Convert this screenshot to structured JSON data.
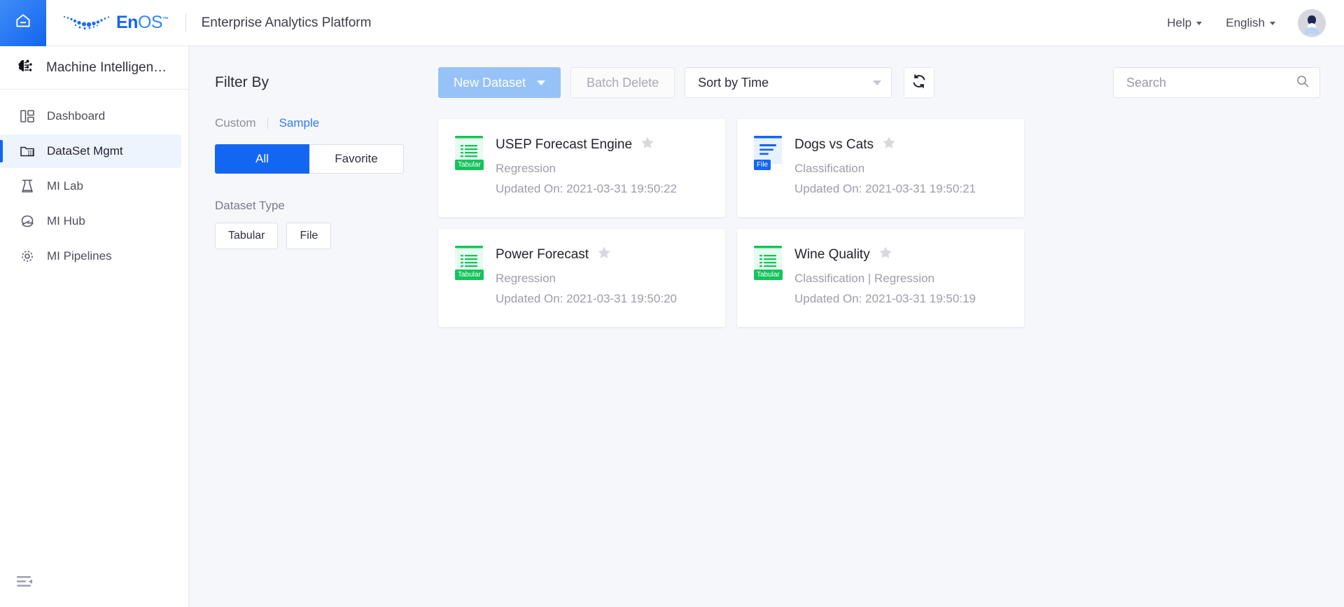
{
  "header": {
    "home_icon": "home-icon",
    "logo_en": "En",
    "logo_os": "OS",
    "logo_tm": "™",
    "platform_title": "Enterprise Analytics Platform",
    "help_label": "Help",
    "language_label": "English",
    "avatar_alt": "user-avatar"
  },
  "sidebar": {
    "module_title": "Machine Intelligen…",
    "module_icon": "brain-chip-icon",
    "items": [
      {
        "label": "Dashboard",
        "icon": "dashboard-icon",
        "active": false
      },
      {
        "label": "DataSet Mgmt",
        "icon": "dataset-folder-icon",
        "active": true
      },
      {
        "label": "MI Lab",
        "icon": "flask-icon",
        "active": false
      },
      {
        "label": "MI Hub",
        "icon": "hub-icon",
        "active": false
      },
      {
        "label": "MI Pipelines",
        "icon": "pipeline-gear-icon",
        "active": false
      }
    ],
    "collapse_icon": "collapse-sidebar-icon"
  },
  "filter": {
    "title": "Filter By",
    "source_links": [
      {
        "label": "Custom",
        "selected": false
      },
      {
        "label": "Sample",
        "selected": true
      }
    ],
    "scope_buttons": [
      {
        "label": "All",
        "selected": true
      },
      {
        "label": "Favorite",
        "selected": false
      }
    ],
    "dataset_type_label": "Dataset Type",
    "dataset_type_chips": [
      {
        "label": "Tabular",
        "selected": false
      },
      {
        "label": "File",
        "selected": false
      }
    ]
  },
  "toolbar": {
    "new_dataset_label": "New Dataset",
    "batch_delete_label": "Batch Delete",
    "sort_value": "Sort by Time",
    "refresh_icon": "refresh-icon",
    "search_placeholder": "Search",
    "search_value": "",
    "search_icon": "search-icon"
  },
  "colors": {
    "brand_blue": "#1464f0",
    "primary_disabled": "#96c2f7",
    "tabular_green": "#14c45a",
    "file_blue": "#1366f1",
    "link_blue": "#2f7bf4"
  },
  "cards": [
    {
      "title": "USEP Forecast Engine",
      "type": "Tabular",
      "category": "Regression",
      "updated": "Updated On: 2021-03-31 19:50:22",
      "favorited": false
    },
    {
      "title": "Dogs vs Cats",
      "type": "File",
      "category": "Classification",
      "updated": "Updated On: 2021-03-31 19:50:21",
      "favorited": false
    },
    {
      "title": "Power Forecast",
      "type": "Tabular",
      "category": "Regression",
      "updated": "Updated On: 2021-03-31 19:50:20",
      "favorited": false
    },
    {
      "title": "Wine Quality",
      "type": "Tabular",
      "category": "Classification | Regression",
      "updated": "Updated On: 2021-03-31 19:50:19",
      "favorited": false
    }
  ]
}
